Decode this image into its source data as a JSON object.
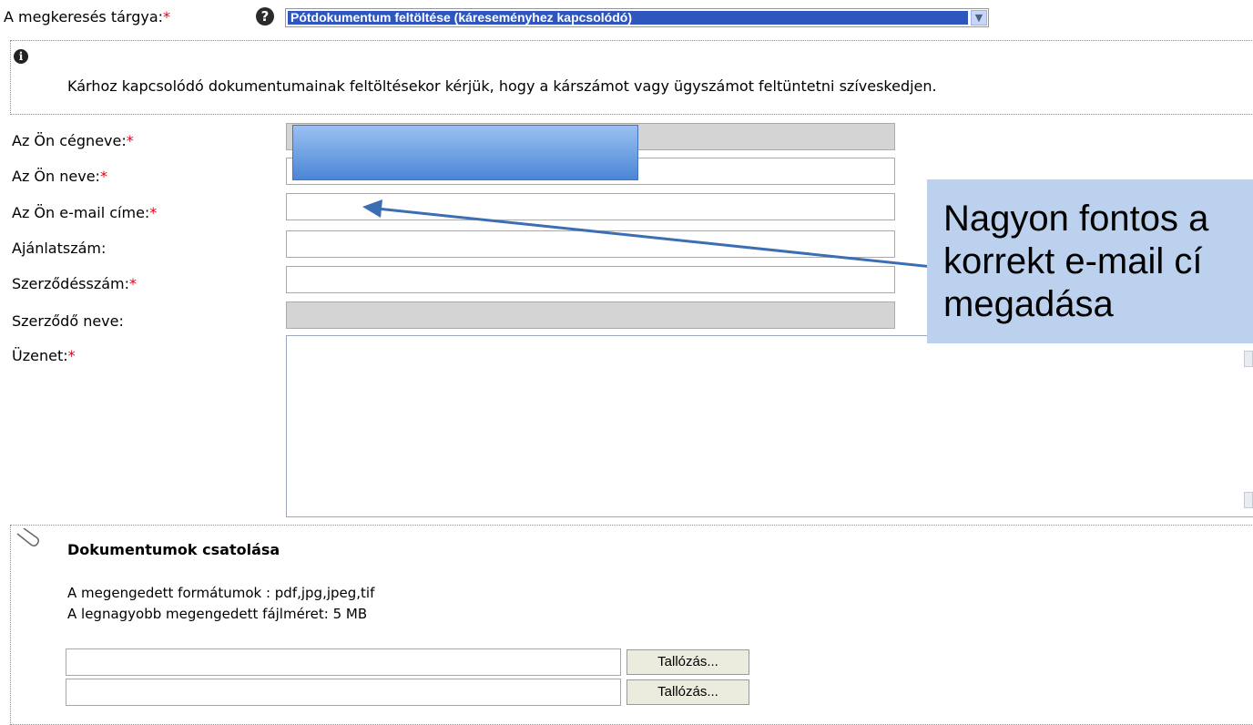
{
  "subject": {
    "label": "A megkeresés tárgya:",
    "required_mark": "*",
    "help_icon": "?",
    "selected_value": "Pótdokumentum feltöltése (káreseményhez kapcsolódó)",
    "dropdown_arrow": "▼"
  },
  "info": {
    "icon": "i",
    "text": "Kárhoz kapcsolódó dokumentumainak feltöltésekor kérjük, hogy a kárszámot vagy ügyszámot feltüntetni szíveskedjen."
  },
  "form": {
    "company_label": "Az Ön cégneve:",
    "name_label": "Az Ön neve:",
    "email_label": "Az Ön e-mail címe:",
    "offer_label": "Ajánlatszám:",
    "contract_label": "Szerződésszám:",
    "contractor_label": "Szerződő neve:",
    "message_label": "Üzenet:",
    "required_mark": "*",
    "email_value": "",
    "offer_value": "",
    "contract_value": "",
    "message_value": ""
  },
  "callout": {
    "line1": "Nagyon fontos a",
    "line2": "korrekt e-mail cí",
    "line3": "megadása"
  },
  "attachments": {
    "title": "Dokumentumok csatolása",
    "formats": "A megengedett formátumok : pdf,jpg,jpeg,tif",
    "max_size": "A legnagyobb megengedett fájlméret: 5 MB",
    "browse_label": "Tallózás..."
  },
  "colors": {
    "required": "#e0001b",
    "selection": "#2f56bf",
    "callout_bg": "#bcd1ed",
    "arrow": "#3c6eb4"
  }
}
